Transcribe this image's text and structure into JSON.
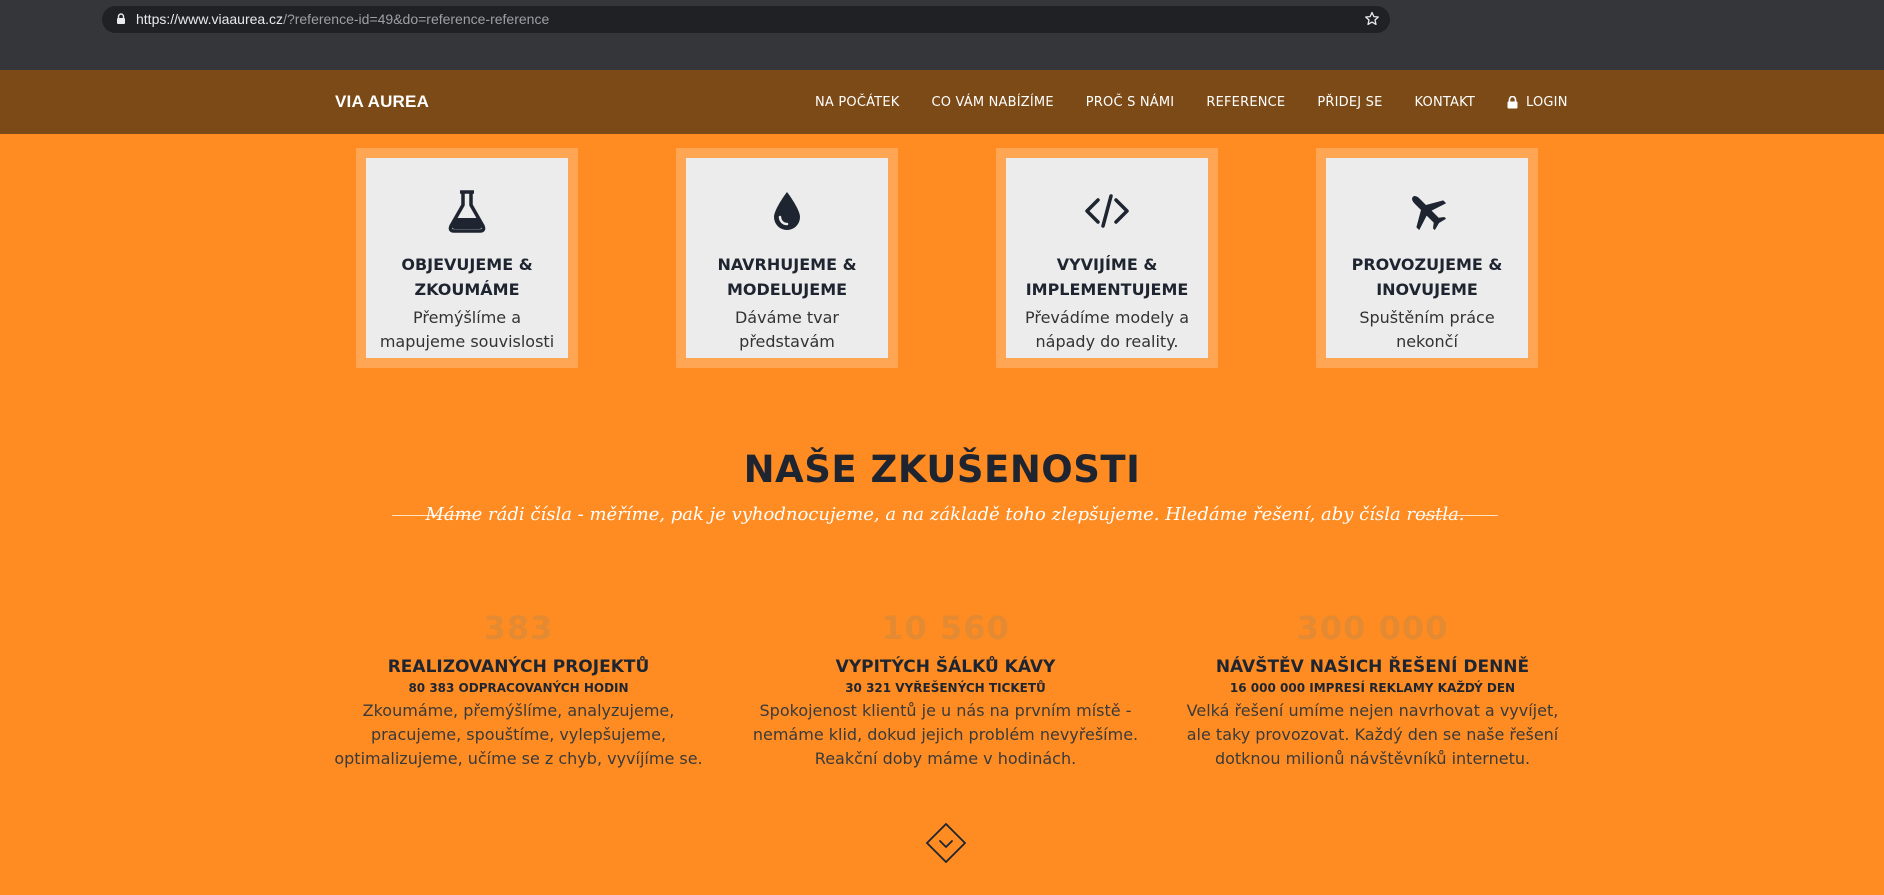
{
  "browser": {
    "url_host": "https://www.viaaurea.cz",
    "url_path": "/?reference-id=49&do=reference-reference"
  },
  "nav": {
    "brand": "VIA AUREA",
    "items": [
      {
        "label": "NA POČÁTEK"
      },
      {
        "label": "CO VÁM NABÍZÍME"
      },
      {
        "label": "PROČ S NÁMI"
      },
      {
        "label": "REFERENCE"
      },
      {
        "label": "PŘIDEJ SE"
      },
      {
        "label": "KONTAKT"
      }
    ],
    "login": "LOGIN"
  },
  "cards": [
    {
      "icon": "flask-icon",
      "title": "OBJEVUJEME & ZKOUMÁME",
      "text": "Přemýšlíme a mapujeme souvislosti"
    },
    {
      "icon": "drop-icon",
      "title": "NAVRHUJEME & MODELUJEME",
      "text": "Dáváme tvar představám"
    },
    {
      "icon": "code-icon",
      "title": "VYVIJÍME & IMPLEMENTUJEME",
      "text": "Převádíme modely a nápady do reality."
    },
    {
      "icon": "plane-icon",
      "title": "PROVOZUJEME & INOVUJEME",
      "text": "Spuštěním práce nekončí"
    }
  ],
  "experience": {
    "title": "NAŠE ZKUŠENOSTI",
    "subtitle": "Máme rádi čísla - měříme, pak je vyhodnocujeme, a na základě toho zlepšujeme. Hledáme řešení, aby čísla rostla."
  },
  "stats": [
    {
      "number": "383",
      "label": "REALIZOVANÝCH PROJEKTŮ",
      "sub": "80 383 ODPRACOVANÝCH HODIN",
      "desc": "Zkoumáme, přemýšlíme, analyzujeme, pracujeme, spouštíme, vylepšujeme, optimalizujeme, učíme se z chyb, vyvíjíme se."
    },
    {
      "number": "10 560",
      "label": "VYPITÝCH ŠÁLKŮ KÁVY",
      "sub": "30 321 VYŘEŠENÝCH TICKETŮ",
      "desc": "Spokojenost klientů je u nás na prvním místě - nemáme klid, dokud jejich problém nevyřešíme. Reakční doby máme v hodinách."
    },
    {
      "number": "300 000",
      "label": "NÁVŠTĚV NAŠICH ŘEŠENÍ DENNĚ",
      "sub": "16 000 000 IMPRESÍ REKLAMY KAŽDÝ DEN",
      "desc": "Velká řešení umíme nejen navrhovat a vyvíjet, ale taky provozovat. Každý den se naše řešení dotknou milionů návštěvníků internetu."
    }
  ],
  "colors": {
    "page_bg": "#ff8c22",
    "nav_bg": "#7c4a16",
    "card_border": "#ffa654",
    "card_bg": "#ececec",
    "dark_text": "#1e2530",
    "stat_number": "#e38a33"
  }
}
